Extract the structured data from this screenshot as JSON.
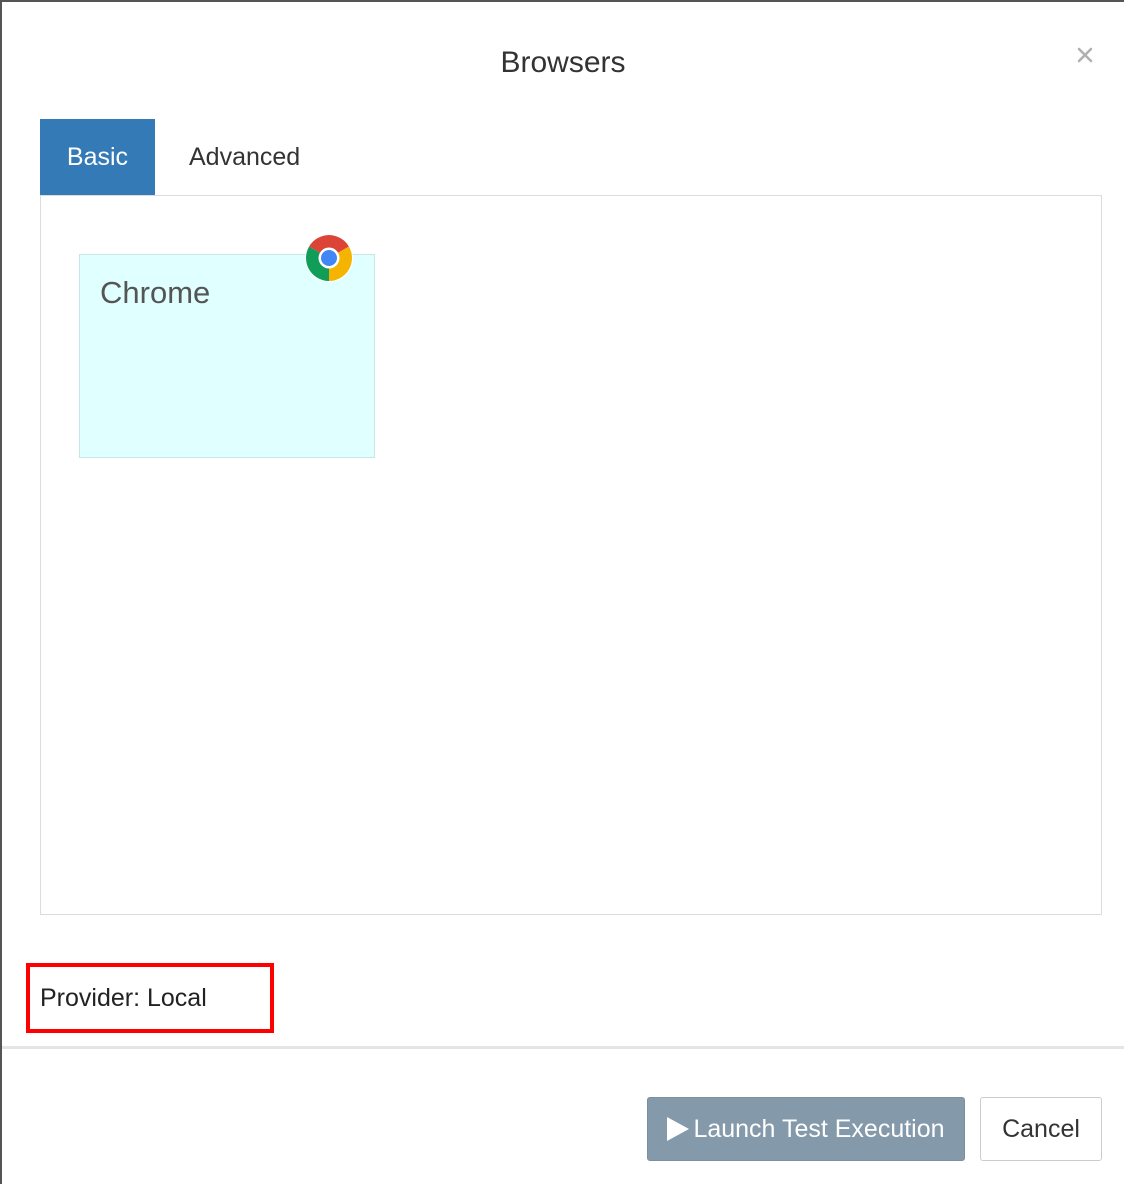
{
  "modal": {
    "title": "Browsers",
    "close_icon": "close-icon"
  },
  "tabs": [
    {
      "label": "Basic",
      "active": true
    },
    {
      "label": "Advanced",
      "active": false
    }
  ],
  "browsers": [
    {
      "name": "Chrome",
      "icon": "chrome-icon"
    }
  ],
  "provider": {
    "text": "Provider: Local",
    "highlight_color": "#ff0000"
  },
  "footer": {
    "launch_label": "Launch Test Execution",
    "launch_icon": "play-icon",
    "cancel_label": "Cancel"
  },
  "colors": {
    "tab_active_bg": "#337ab7",
    "card_bg": "#e0ffff",
    "launch_bg": "#8499aa"
  }
}
